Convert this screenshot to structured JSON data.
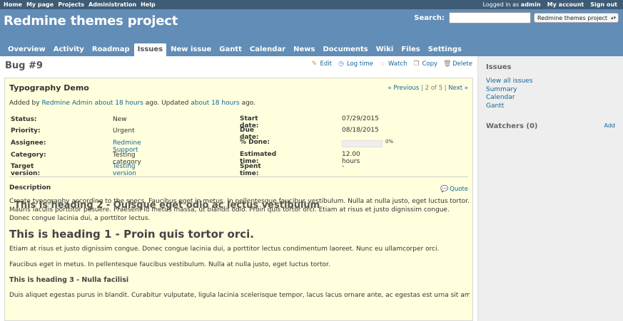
{
  "top_menu": {
    "left": [
      "Home",
      "My page",
      "Projects",
      "Administration",
      "Help"
    ],
    "logged_prefix": "Logged in as ",
    "logged_user": "admin",
    "my_account": "My account",
    "sign_out": "Sign out"
  },
  "header": {
    "title": "Redmine themes project",
    "search_label": "Search:",
    "search_value": "",
    "project_select": "Redmine themes project"
  },
  "tabs": [
    "Overview",
    "Activity",
    "Roadmap",
    "Issues",
    "New issue",
    "Gantt",
    "Calendar",
    "News",
    "Documents",
    "Wiki",
    "Files",
    "Settings"
  ],
  "selected_tab": "Issues",
  "page": {
    "title": "Bug #9",
    "actions": [
      "Edit",
      "Log time",
      "Watch",
      "Copy",
      "Delete"
    ]
  },
  "issue": {
    "subject": "Typography Demo",
    "nav_prev": "« Previous",
    "nav_sep1": " | ",
    "nav_count": "2 of 5",
    "nav_sep2": " | ",
    "nav_next": "Next »",
    "author_prefix": "Added by ",
    "author": "Redmine Admin",
    "space": " ",
    "added_ago": "about 18 hours",
    "mid": " ago. Updated ",
    "updated_ago": "about 18 hours",
    "tail": " ago.",
    "attributes_left": [
      {
        "label": "Status:",
        "value": "New",
        "link": false
      },
      {
        "label": "Priority:",
        "value": "Urgent",
        "link": false
      },
      {
        "label": "Assignee:",
        "value": "Redmine Support",
        "link": true
      },
      {
        "label": "Category:",
        "value": "Testing category",
        "link": false
      },
      {
        "label": "Target version:",
        "value": "Testing version",
        "link": true
      }
    ],
    "attributes_right": [
      {
        "label": "Start date:",
        "value": "07/29/2015"
      },
      {
        "label": "Due date:",
        "value": "08/18/2015"
      },
      {
        "label": "% Done:",
        "value": "0%"
      },
      {
        "label": "Estimated time:",
        "value": "12.00 hours"
      },
      {
        "label": "Spent time:",
        "value": "-"
      }
    ],
    "done_ratio": 0,
    "description_title": "Description",
    "quote": "Quote",
    "description": {
      "p1": "Create typography according to the specs. Faucibus eget in metus. In pellentesque faucibus vestibulum. Nulla at nulla justo, eget luctus tortor. Mauris iaculis porttitor posuere. Praesent id metus massa, ut blandit odio. Proin quis tortor orci. Etiam at risus et justo dignissim congue. Donec congue lacinia dui, a porttitor lectus.",
      "h1": "This is heading 1 - Proin quis tortor orci.",
      "p2": "Etiam at risus et justo dignissim congue. Donec congue lacinia dui, a porttitor lectus condimentum laoreet. Nunc eu ullamcorper orci.",
      "h2": "This is heading 2 - Quisque eget odio ac lectus vestibulum",
      "p3": "Faucibus eget in metus. In pellentesque faucibus vestibulum. Nulla at nulla justo, eget luctus tortor.",
      "h3": "This is heading 3 - Nulla facilisi",
      "p4": "Duis aliquet egestas purus in blandit. Curabitur vulputate, ligula lacinia scelerisque tempor, lacus lacus ornare ante, ac egestas est urna sit amet"
    }
  },
  "sidebar": {
    "title": "Issues",
    "links": [
      "View all issues",
      "Summary",
      "Calendar",
      "Gantt"
    ],
    "watchers_title": "Watchers (0)",
    "add": "Add"
  },
  "colors": {
    "top_menu_bg": "#3e5b76",
    "header_bg": "#628db6",
    "link": "#169",
    "issue_bg": "#ffffdd",
    "sidebar_bg": "#eeeeee"
  },
  "icons": {
    "edit": "pencil-icon",
    "log_time": "clock-icon",
    "watch": "star-icon",
    "copy": "copy-icon",
    "delete": "trash-icon",
    "quote": "speech-bubble-icon"
  }
}
